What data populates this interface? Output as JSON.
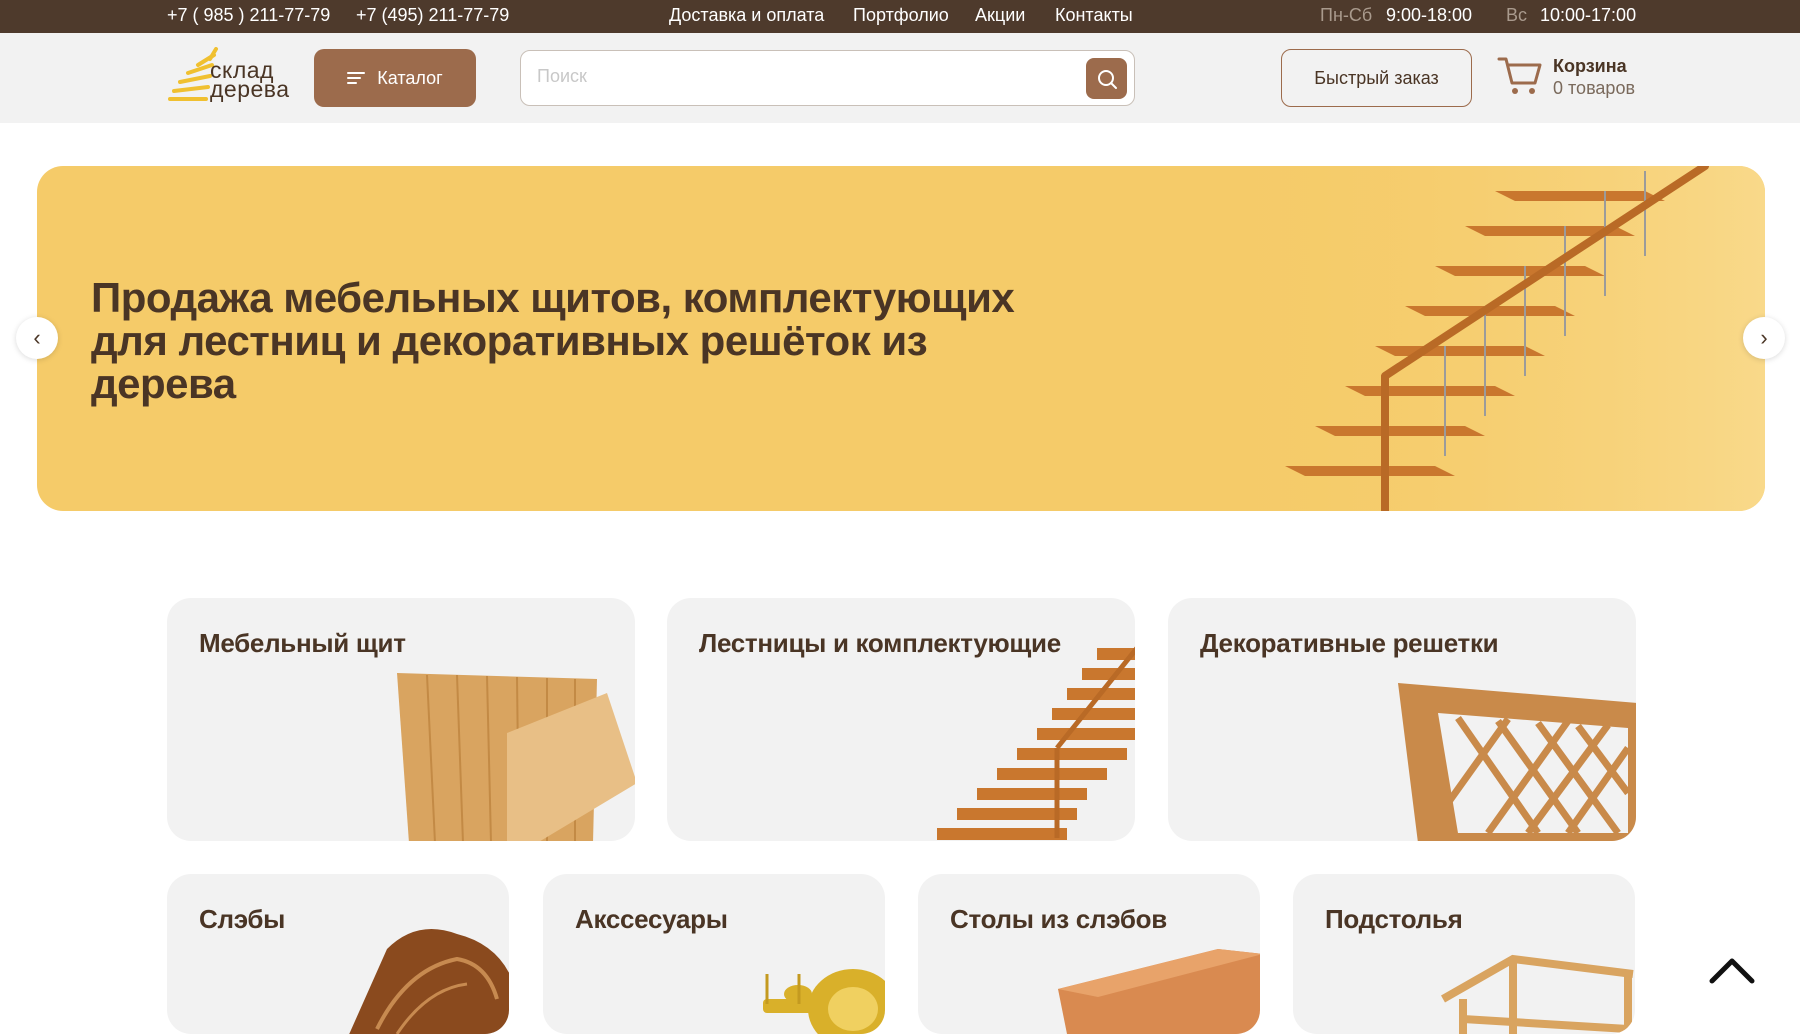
{
  "topbar": {
    "phone1": "+7 ( 985 ) 211-77-79",
    "phone2": "+7 (495) 211-77-79",
    "nav": [
      "Доставка и оплата",
      "Портфолио",
      "Акции",
      "Контакты"
    ],
    "hours": [
      {
        "days": "Пн-Сб",
        "time": "9:00-18:00"
      },
      {
        "days": "Вс",
        "time": "10:00-17:00"
      }
    ]
  },
  "header": {
    "logo_line1": "склад",
    "logo_line2": "дерева",
    "catalog_label": "Каталог",
    "search_placeholder": "Поиск",
    "quick_order_label": "Быстрый заказ",
    "cart_title": "Корзина",
    "cart_count": "0 товаров"
  },
  "hero": {
    "title": "Продажа мебельных щитов, комплектующих для лестниц и декоративных решёток из дерева",
    "prev_icon": "‹",
    "next_icon": "›"
  },
  "categories_row1": [
    "Мебельный щит",
    "Лестницы и комплектующие",
    "Декоративные решетки"
  ],
  "categories_row2": [
    "Слэбы",
    "Акссесуары",
    "Столы из слэбов",
    "Подстолья"
  ],
  "colors": {
    "topbar": "#4e3a2c",
    "accent": "#9c6b4c",
    "hero": "#f5cb69",
    "text": "#4a3525",
    "card": "#f2f2f2"
  }
}
